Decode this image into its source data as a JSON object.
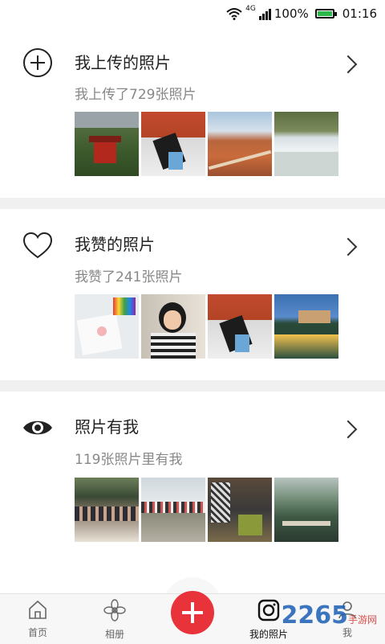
{
  "status_bar": {
    "network": "4G",
    "battery": "100%",
    "time": "01:16"
  },
  "sections": [
    {
      "icon": "add-circle-icon",
      "title": "我上传的照片",
      "subtitle": "我上传了729张照片"
    },
    {
      "icon": "heart-icon",
      "title": "我赞的照片",
      "subtitle": "我赞了241张照片"
    },
    {
      "icon": "eye-icon",
      "title": "照片有我",
      "subtitle": "119张照片里有我"
    }
  ],
  "nav": {
    "home": "首页",
    "album": "相册",
    "add": "add-icon",
    "my_photos": "我的照片",
    "me": "我"
  },
  "watermark": {
    "text": "2265",
    "sub": "手游网",
    "suffix": ".com"
  },
  "colors": {
    "accent": "#e8333a",
    "battery": "#2db84c"
  }
}
